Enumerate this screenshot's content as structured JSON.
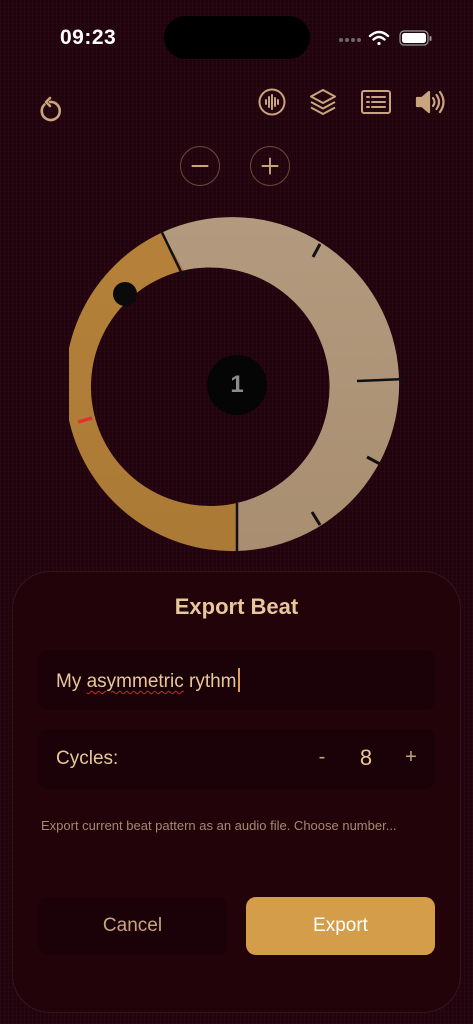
{
  "status_bar": {
    "time": "09:23"
  },
  "toolbar": {
    "icons": [
      "reset-icon",
      "waveform-icon",
      "layers-icon",
      "list-icon",
      "speaker-icon"
    ]
  },
  "zoom_controls": {
    "decrease": "minus-icon",
    "increase": "plus-icon"
  },
  "wheel": {
    "current_beat": "1",
    "colors": {
      "light_segment": "#b1967a",
      "dark_segment": "#b08038",
      "marker": "#e0322f"
    }
  },
  "export_sheet": {
    "title": "Export Beat",
    "name_input": {
      "value_prefix": "My ",
      "value_misspelled": "asymmetric",
      "value_suffix": " rythm"
    },
    "cycles": {
      "label": "Cycles:",
      "decrement": "-",
      "value": "8",
      "increment": "+"
    },
    "description": "Export current beat pattern as an audio file. Choose number...",
    "cancel_label": "Cancel",
    "export_label": "Export"
  },
  "colors": {
    "background": "#22030d",
    "accent": "#d39d4a",
    "text": "#e8c79a"
  }
}
